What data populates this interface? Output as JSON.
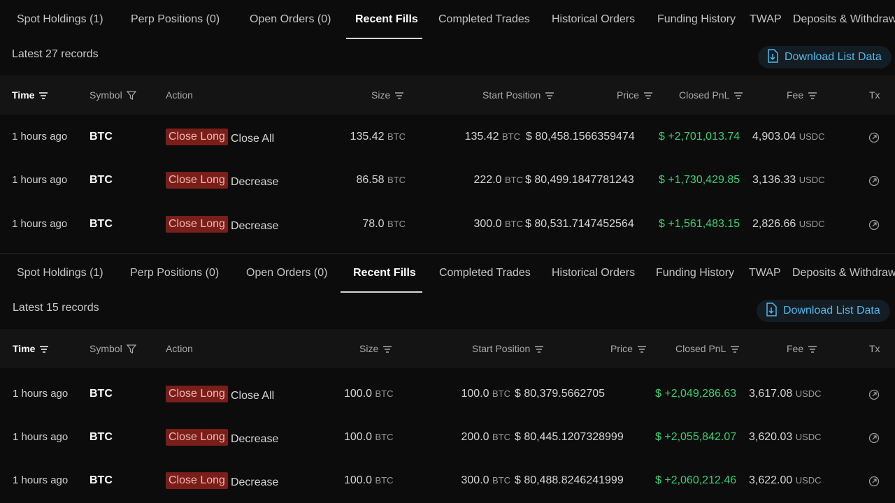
{
  "colors": {
    "accent": "#52b8e8",
    "profit": "#3ecf6f",
    "badge_bg": "#7a1e1a"
  },
  "panels": [
    {
      "tabs": [
        "Spot Holdings (1)",
        "Perp Positions (0)",
        "Open Orders (0)",
        "Recent Fills",
        "Completed Trades",
        "Historical Orders",
        "Funding History",
        "TWAP",
        "Deposits & Withdraw"
      ],
      "active_tab": 3,
      "records_label": "Latest 27 records",
      "download_label": "Download List Data",
      "headers": {
        "time": "Time",
        "symbol": "Symbol",
        "action": "Action",
        "size": "Size",
        "start": "Start Position",
        "price": "Price",
        "pnl": "Closed PnL",
        "fee": "Fee",
        "tx": "Tx"
      },
      "rows": [
        {
          "time": "1 hours ago",
          "symbol": "BTC",
          "badge": "Close Long",
          "action": "Close All",
          "size": "135.42",
          "size_unit": "BTC",
          "start": "135.42",
          "start_unit": "BTC",
          "price": "$ 80,458.1566359474",
          "pnl": "$ +2,701,013.74",
          "fee": "4,903.04",
          "fee_unit": "USDC"
        },
        {
          "time": "1 hours ago",
          "symbol": "BTC",
          "badge": "Close Long",
          "action": "Decrease",
          "size": "86.58",
          "size_unit": "BTC",
          "start": "222.0",
          "start_unit": "BTC",
          "price": "$ 80,499.1847781243",
          "pnl": "$ +1,730,429.85",
          "fee": "3,136.33",
          "fee_unit": "USDC"
        },
        {
          "time": "1 hours ago",
          "symbol": "BTC",
          "badge": "Close Long",
          "action": "Decrease",
          "size": "78.0",
          "size_unit": "BTC",
          "start": "300.0",
          "start_unit": "BTC",
          "price": "$ 80,531.7147452564",
          "pnl": "$ +1,561,483.15",
          "fee": "2,826.66",
          "fee_unit": "USDC"
        }
      ]
    },
    {
      "tabs": [
        "Spot Holdings (1)",
        "Perp Positions (0)",
        "Open Orders (0)",
        "Recent Fills",
        "Completed Trades",
        "Historical Orders",
        "Funding History",
        "TWAP",
        "Deposits & Withdraw"
      ],
      "active_tab": 3,
      "records_label": "Latest 15 records",
      "download_label": "Download List Data",
      "headers": {
        "time": "Time",
        "symbol": "Symbol",
        "action": "Action",
        "size": "Size",
        "start": "Start Position",
        "price": "Price",
        "pnl": "Closed PnL",
        "fee": "Fee",
        "tx": "Tx"
      },
      "rows": [
        {
          "time": "1 hours ago",
          "symbol": "BTC",
          "badge": "Close Long",
          "action": "Close All",
          "size": "100.0",
          "size_unit": "BTC",
          "start": "100.0",
          "start_unit": "BTC",
          "price": "$ 80,379.5662705",
          "pnl": "$ +2,049,286.63",
          "fee": "3,617.08",
          "fee_unit": "USDC"
        },
        {
          "time": "1 hours ago",
          "symbol": "BTC",
          "badge": "Close Long",
          "action": "Decrease",
          "size": "100.0",
          "size_unit": "BTC",
          "start": "200.0",
          "start_unit": "BTC",
          "price": "$ 80,445.1207328999",
          "pnl": "$ +2,055,842.07",
          "fee": "3,620.03",
          "fee_unit": "USDC"
        },
        {
          "time": "1 hours ago",
          "symbol": "BTC",
          "badge": "Close Long",
          "action": "Decrease",
          "size": "100.0",
          "size_unit": "BTC",
          "start": "300.0",
          "start_unit": "BTC",
          "price": "$ 80,488.8246241999",
          "pnl": "$ +2,060,212.46",
          "fee": "3,622.00",
          "fee_unit": "USDC"
        }
      ]
    }
  ]
}
